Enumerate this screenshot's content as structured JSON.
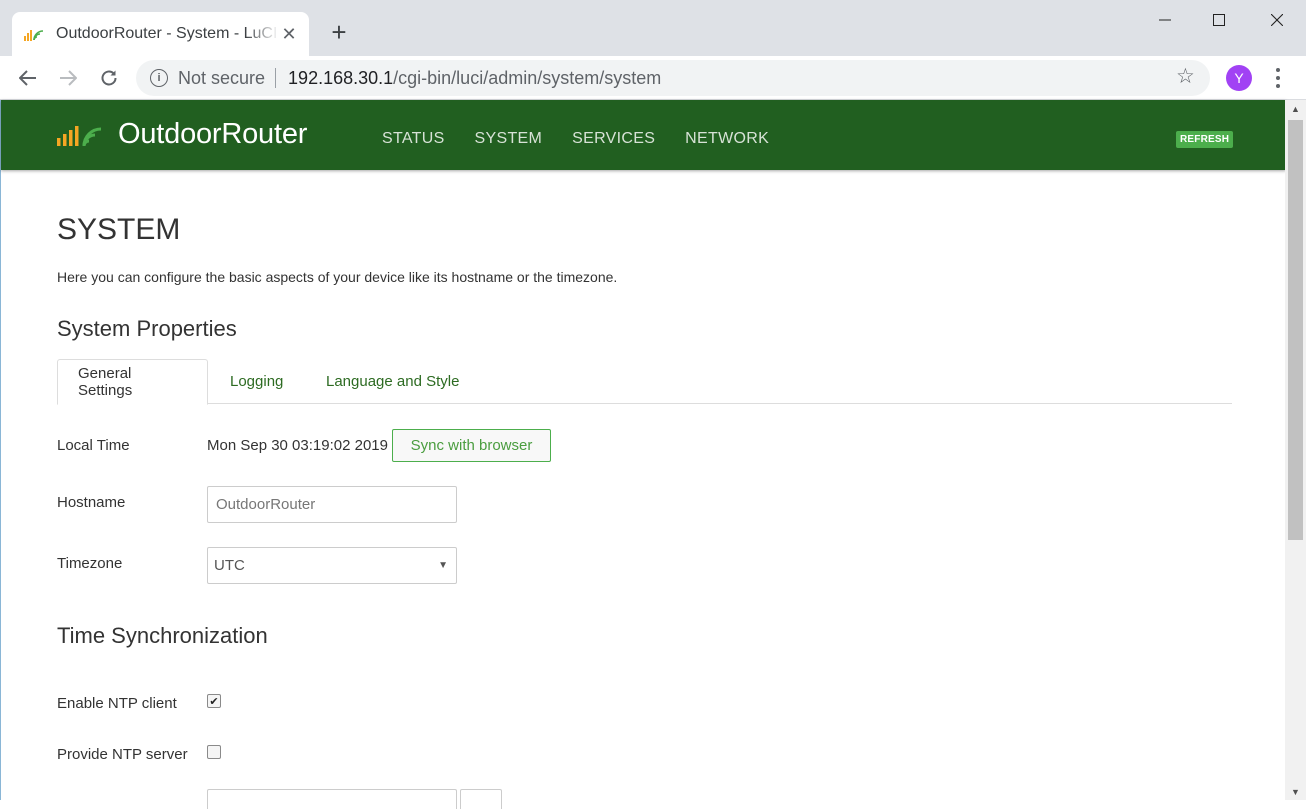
{
  "browser": {
    "tab_title": "OutdoorRouter - System - LuCI",
    "new_tab_glyph": "+",
    "security_label": "Not secure",
    "url_host": "192.168.30.1",
    "url_path": "/cgi-bin/luci/admin/system/system",
    "profile_initial": "Y",
    "icons": [
      "back-icon",
      "forward-icon",
      "reload-icon",
      "info-icon",
      "star-icon",
      "kebab-menu-icon",
      "minimize-icon",
      "maximize-icon",
      "close-icon"
    ]
  },
  "header": {
    "brand": "OutdoorRouter",
    "nav": [
      "STATUS",
      "SYSTEM",
      "SERVICES",
      "NETWORK"
    ],
    "refresh_label": "REFRESH",
    "colors": {
      "header_bg": "#215f20",
      "accent": "#4cae4c",
      "logo_orange": "#f5a623"
    }
  },
  "page": {
    "title": "SYSTEM",
    "description": "Here you can configure the basic aspects of your device like its hostname or the timezone.",
    "section1": "System Properties",
    "tabs": [
      "General Settings",
      "Logging",
      "Language and Style"
    ],
    "active_tab": "General Settings",
    "fields": {
      "local_time_label": "Local Time",
      "local_time_value": "Mon Sep 30 03:19:02 2019",
      "sync_button": "Sync with browser",
      "hostname_label": "Hostname",
      "hostname_placeholder": "OutdoorRouter",
      "timezone_label": "Timezone",
      "timezone_value": "UTC"
    },
    "section2": "Time Synchronization",
    "ntp": {
      "enable_client_label": "Enable NTP client",
      "enable_client_checked": true,
      "provide_server_label": "Provide NTP server",
      "provide_server_checked": false,
      "check_glyph": "✔"
    }
  }
}
